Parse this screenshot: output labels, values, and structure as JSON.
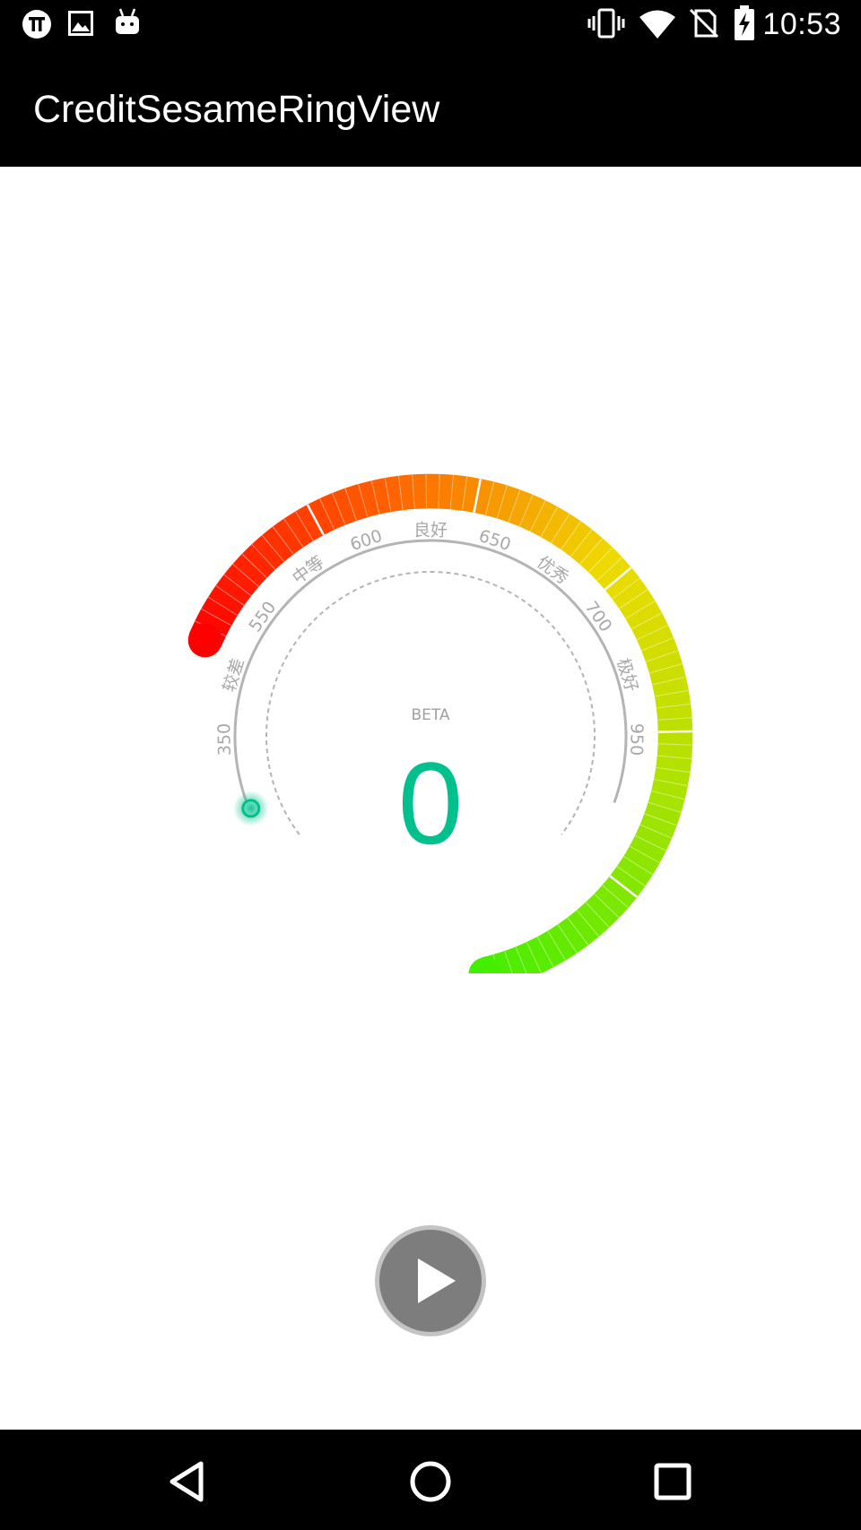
{
  "status_bar": {
    "time": "10:53",
    "left_icons": [
      "pi-icon",
      "image-icon",
      "android-icon"
    ],
    "right_icons": [
      "vibrate-icon",
      "wifi-icon",
      "no-sim-icon",
      "battery-charging-icon"
    ]
  },
  "app_bar": {
    "title": "CreditSesameRingView"
  },
  "gauge": {
    "beta_label": "BETA",
    "score": "0",
    "score_color": "#00c18e",
    "start_color": "#ff0000",
    "end_color": "#44ee00",
    "ticks": [
      {
        "text": "350"
      },
      {
        "text": "较差"
      },
      {
        "text": "550"
      },
      {
        "text": "中等"
      },
      {
        "text": "600"
      },
      {
        "text": "良好"
      },
      {
        "text": "650"
      },
      {
        "text": "优秀"
      },
      {
        "text": "700"
      },
      {
        "text": "极好"
      },
      {
        "text": "950"
      }
    ]
  },
  "play_button": {
    "icon": "play-icon"
  },
  "nav_bar": {
    "icons": [
      "back-icon",
      "home-icon",
      "recents-icon"
    ]
  }
}
